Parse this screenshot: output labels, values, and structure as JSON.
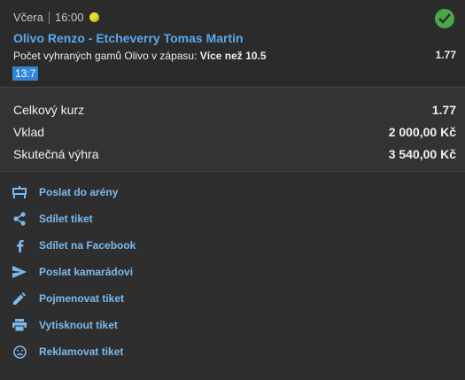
{
  "ticket": {
    "day": "Včera",
    "time": "16:00",
    "match": "Olivo Renzo - Etcheverry Tomas Martin",
    "pick_prefix": "Počet vyhraných gamů Olivo v zápasu: ",
    "pick_value": "Více než 10.5",
    "pick_odds": "1.77",
    "score": "13:7"
  },
  "summary": {
    "total_odds_label": "Celkový kurz",
    "total_odds_value": "1.77",
    "stake_label": "Vklad",
    "stake_value": "2 000,00 Kč",
    "win_label": "Skutečná výhra",
    "win_value": "3 540,00 Kč"
  },
  "actions": [
    {
      "label": "Poslat do arény",
      "icon": "arena-icon"
    },
    {
      "label": "Sdílet tiket",
      "icon": "share-icon"
    },
    {
      "label": "Sdílet na Facebook",
      "icon": "facebook-icon"
    },
    {
      "label": "Poslat kamarádovi",
      "icon": "send-icon"
    },
    {
      "label": "Pojmenovat tiket",
      "icon": "pencil-icon"
    },
    {
      "label": "Vytisknout tiket",
      "icon": "printer-icon"
    },
    {
      "label": "Reklamovat tiket",
      "icon": "sad-face-icon"
    }
  ],
  "colors": {
    "accent": "#5aa8ea",
    "link": "#7cb9ee",
    "success": "#4aa84a",
    "score_bg": "#2f86d6",
    "background": "#2e2e2e"
  }
}
